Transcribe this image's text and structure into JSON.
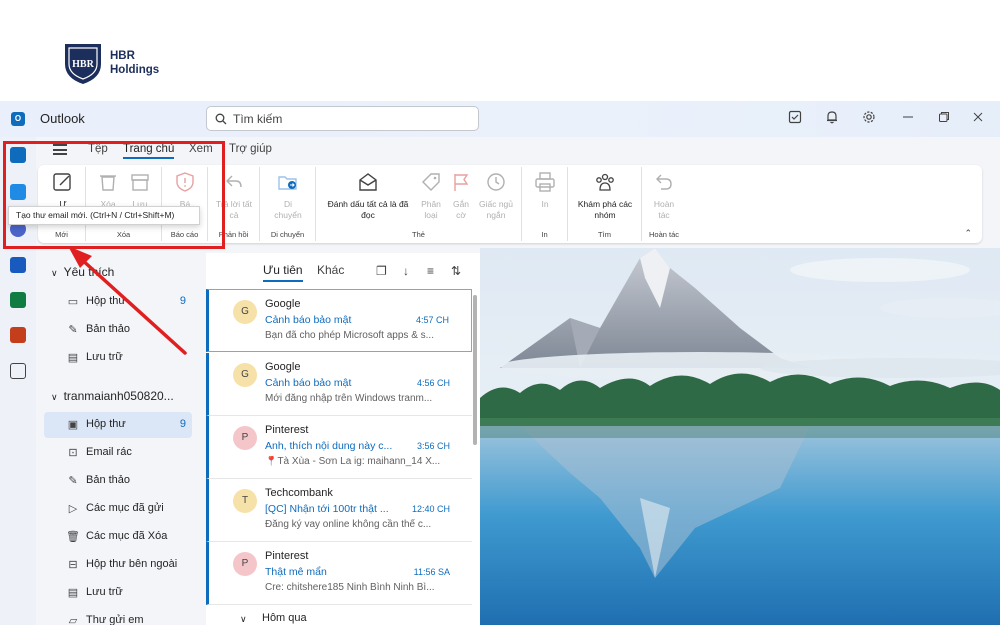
{
  "brand": {
    "logo_initials": "HBR",
    "name_line1": "HBR",
    "name_line2": "Holdings"
  },
  "titlebar": {
    "app_name": "Outlook",
    "search_placeholder": "Tìm kiếm"
  },
  "menu": {
    "tabs": [
      "Tệp",
      "Trang chủ",
      "Xem",
      "Trợ giúp"
    ],
    "active_tab": "Trang chủ"
  },
  "ribbon": {
    "groups": {
      "new": "Mới",
      "delete": "Xóa",
      "report": "Báo cáo",
      "respond": "Phản hồi",
      "move": "Di chuyển",
      "tags": "Thẻ",
      "in": "In",
      "find": "Tìm",
      "undo": "Hoàn tác"
    },
    "buttons": {
      "new_mail": "Ư",
      "delete": "Xóa",
      "archive": "Lưu",
      "report": "Bá",
      "reply_all_1": "Trả lời tất",
      "reply_all_2": "cả",
      "move_1": "Di",
      "move_2": "chuyển",
      "mark_all_read_1": "Đánh dấu tất cả là đã",
      "mark_all_read_2": "đọc",
      "categorize_1": "Phân",
      "categorize_2": "loại",
      "flag_1": "Gắn",
      "flag_2": "cờ",
      "snooze_1": "Giấc ngủ",
      "snooze_2": "ngắn",
      "print": "In",
      "discover_groups_1": "Khám phá các",
      "discover_groups_2": "nhóm",
      "undo_1": "Hoàn",
      "undo_2": "tác"
    },
    "tooltip": "Tạo thư email mới. (Ctrl+N / Ctrl+Shift+M)"
  },
  "folders": {
    "favorites_header": "Yêu thích",
    "favorites": [
      {
        "label": "Hộp thư",
        "count": "9"
      },
      {
        "label": "Bản thảo",
        "count": ""
      },
      {
        "label": "Lưu trữ",
        "count": ""
      }
    ],
    "account_header": "tranmaianh050820...",
    "account_items": [
      {
        "label": "Hộp thư",
        "count": "9"
      },
      {
        "label": "Email rác",
        "count": ""
      },
      {
        "label": "Bản thảo",
        "count": ""
      },
      {
        "label": "Các mục đã gửi",
        "count": ""
      },
      {
        "label": "Các mục đã Xóa",
        "count": ""
      },
      {
        "label": "Hộp thư bên ngoài",
        "count": ""
      },
      {
        "label": "Lưu trữ",
        "count": ""
      },
      {
        "label": "Thư gửi em",
        "count": ""
      }
    ]
  },
  "message_list": {
    "tab_focused": "Ưu tiên",
    "tab_other": "Khác",
    "messages": [
      {
        "initial": "G",
        "sender": "Google",
        "subject": "Cảnh báo bảo mật",
        "time": "4:57 CH",
        "preview": "Bạn đã cho phép Microsoft apps & s...",
        "avatar_color": "#f6e2a8"
      },
      {
        "initial": "G",
        "sender": "Google",
        "subject": "Cảnh báo bảo mật",
        "time": "4:56 CH",
        "preview": "Mới đăng nhập trên Windows tranm...",
        "avatar_color": "#f6e2a8"
      },
      {
        "initial": "P",
        "sender": "Pinterest",
        "subject": "Anh, thích nội dung này c...",
        "time": "3:56 CH",
        "preview": "📍Tà Xùa - Sơn La ig: maihann_14 X...",
        "avatar_color": "#f4c6ca"
      },
      {
        "initial": "T",
        "sender": "Techcombank",
        "subject": "[QC] Nhận tới 100tr thật ...",
        "time": "12:40 CH",
        "preview": "Đăng ký vay online không cần thế c...",
        "avatar_color": "#f6e2a8"
      },
      {
        "initial": "P",
        "sender": "Pinterest",
        "subject": "Thật mê mẩn",
        "time": "11:56 SA",
        "preview": "Cre: chitshere185 Ninh Bình Ninh Bì...",
        "avatar_color": "#f4c6ca"
      }
    ],
    "group_yesterday": "Hôm qua"
  },
  "colors": {
    "accent": "#0f6cbd",
    "highlight_red": "#e02020"
  }
}
